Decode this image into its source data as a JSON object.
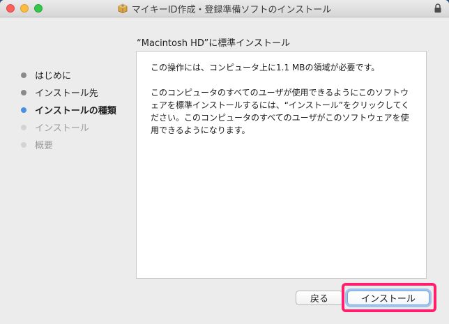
{
  "window": {
    "title": "マイキーID作成・登録準備ソフトのインストール",
    "title_icon": "package-icon",
    "lock_icon": "lock-icon"
  },
  "subtitle": "“Macintosh HD”に標準インストール",
  "steps": [
    {
      "label": "はじめに",
      "state": "done"
    },
    {
      "label": "インストール先",
      "state": "done"
    },
    {
      "label": "インストールの種類",
      "state": "active"
    },
    {
      "label": "インストール",
      "state": "pending"
    },
    {
      "label": "概要",
      "state": "pending"
    }
  ],
  "content": {
    "paragraph1": "この操作には、コンピュータ上に1.1 MBの領域が必要です。",
    "paragraph2": "このコンピュータのすべてのユーザが使用できるようにこのソフトウェアを標準インストールするには、“インストール”をクリックしてください。このコンピュータのすべてのユーザがこのソフトウェアを使用できるようになります。"
  },
  "buttons": {
    "back": "戻る",
    "install": "インストール"
  },
  "colors": {
    "active_dot": "#4a90e2",
    "highlight": "#ff1e6d"
  }
}
